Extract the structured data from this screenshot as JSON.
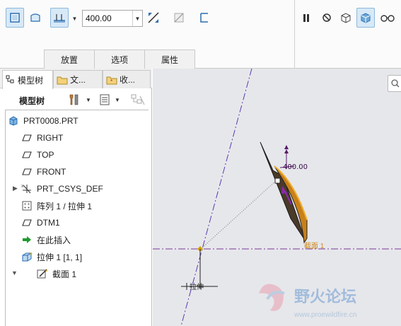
{
  "dashboard": {
    "depth_value": "400.00",
    "tabs": [
      "放置",
      "选项",
      "属性"
    ]
  },
  "panel": {
    "tabs": [
      {
        "label": "模型树"
      },
      {
        "label": "文..."
      },
      {
        "label": "收..."
      }
    ],
    "toolbar_label": "模型树"
  },
  "tree": {
    "items": [
      {
        "label": "PRT0008.PRT",
        "icon": "part-icon"
      },
      {
        "label": "RIGHT",
        "icon": "datum-plane-icon"
      },
      {
        "label": "TOP",
        "icon": "datum-plane-icon"
      },
      {
        "label": "FRONT",
        "icon": "datum-plane-icon"
      },
      {
        "label": "PRT_CSYS_DEF",
        "icon": "csys-icon"
      },
      {
        "label": "阵列 1 / 拉伸 1",
        "icon": "pattern-icon"
      },
      {
        "label": "DTM1",
        "icon": "datum-plane-icon"
      },
      {
        "label": "在此插入",
        "icon": "insert-here-icon"
      },
      {
        "label": "拉伸 1 [1, 1]",
        "icon": "extrude-icon"
      },
      {
        "label": "截面 1",
        "icon": "sketch-icon"
      }
    ]
  },
  "graphics": {
    "dimension_label": "400.00",
    "section_label": "截面 1",
    "extrude_label": "拉伸",
    "watermark_title": "野火论坛",
    "watermark_url": "www.proewildfire.cn"
  },
  "colors": {
    "accent": "#7a2a8a",
    "orange": "#c8801a",
    "panel_border": "#bdbdbd",
    "graphics_bg": "#e6e7eb"
  }
}
